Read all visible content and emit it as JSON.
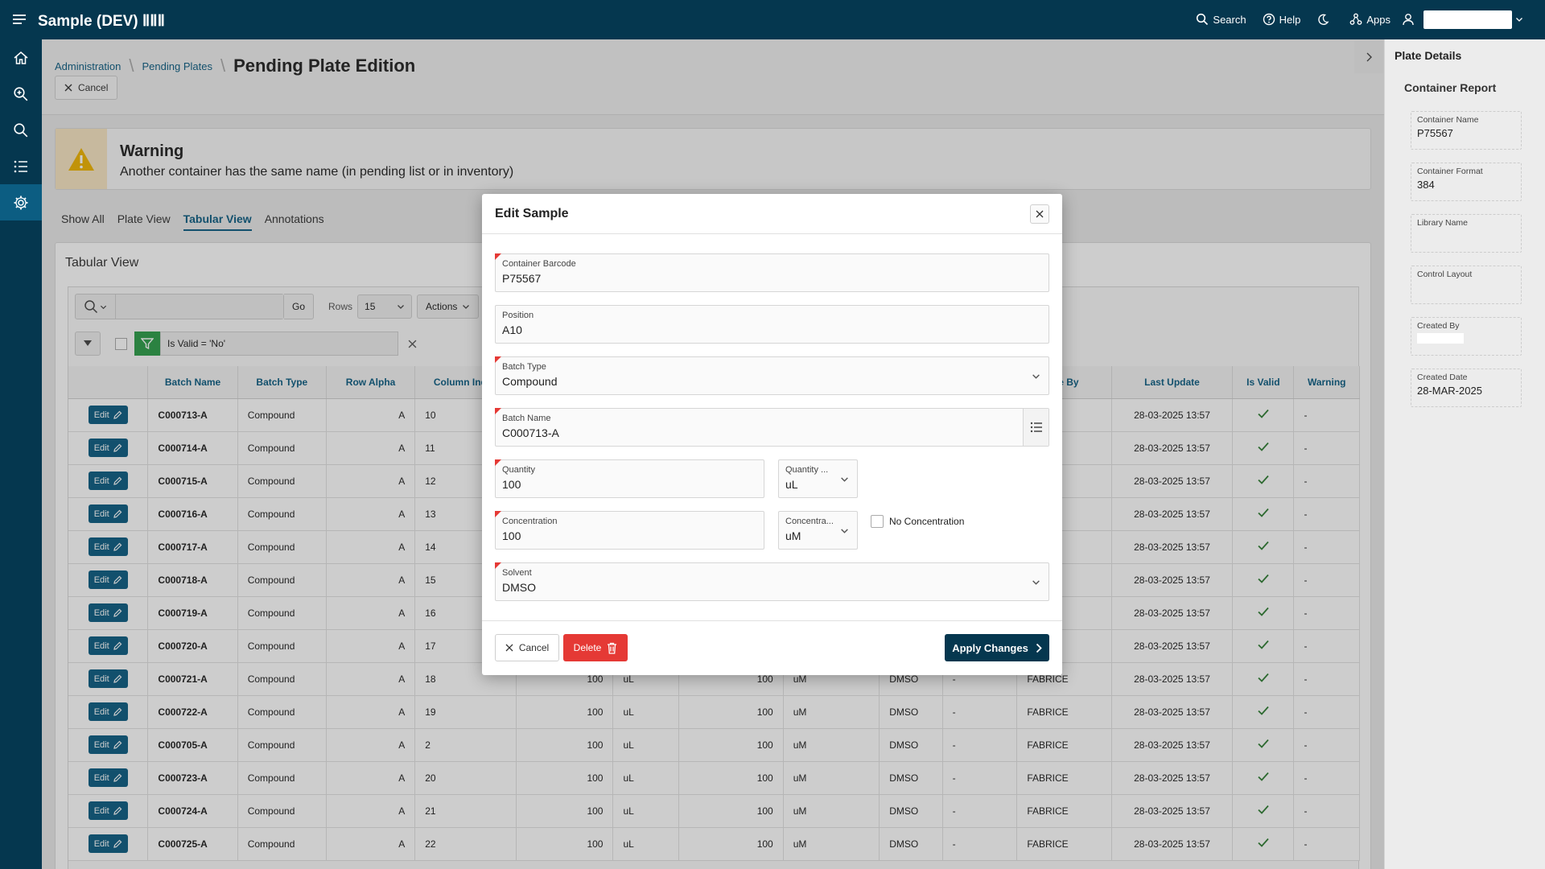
{
  "app": {
    "title": "Sample (DEV) ⅡⅡⅡ"
  },
  "topbar": {
    "search": "Search",
    "help": "Help",
    "apps": "Apps"
  },
  "breadcrumb": {
    "item1": "Administration",
    "item2": "Pending Plates",
    "current": "Pending Plate Edition"
  },
  "header": {
    "cancel_label": "Cancel"
  },
  "warning": {
    "title": "Warning",
    "message": "Another container has the same name (in pending list or in inventory)"
  },
  "tabs": [
    "Show All",
    "Plate View",
    "Tabular View",
    "Annotations"
  ],
  "tabular": {
    "title": "Tabular View",
    "go_label": "Go",
    "rows_label": "Rows",
    "rows_value": "15",
    "actions_label": "Actions",
    "filter_text": "Is Valid = 'No'",
    "edit_label": "Edit",
    "columns": [
      "Batch Name",
      "Batch Type",
      "Row Alpha",
      "Column Index",
      "",
      "",
      "",
      "",
      "",
      "",
      "ate By",
      "Last Update",
      "Is Valid",
      "Warning"
    ],
    "rows": [
      {
        "batch": "C000713-A",
        "type": "Compound",
        "row": "A",
        "col": "10",
        "qty": "",
        "qunit": "",
        "conc": "",
        "cunit": "",
        "solvent": "",
        "ann": "",
        "by": "",
        "update": "28-03-2025 13:57",
        "warning": "-"
      },
      {
        "batch": "C000714-A",
        "type": "Compound",
        "row": "A",
        "col": "11",
        "qty": "",
        "qunit": "",
        "conc": "",
        "cunit": "",
        "solvent": "",
        "ann": "",
        "by": "",
        "update": "28-03-2025 13:57",
        "warning": "-"
      },
      {
        "batch": "C000715-A",
        "type": "Compound",
        "row": "A",
        "col": "12",
        "qty": "",
        "qunit": "",
        "conc": "",
        "cunit": "",
        "solvent": "",
        "ann": "",
        "by": "",
        "update": "28-03-2025 13:57",
        "warning": "-"
      },
      {
        "batch": "C000716-A",
        "type": "Compound",
        "row": "A",
        "col": "13",
        "qty": "",
        "qunit": "",
        "conc": "",
        "cunit": "",
        "solvent": "",
        "ann": "",
        "by": "",
        "update": "28-03-2025 13:57",
        "warning": "-"
      },
      {
        "batch": "C000717-A",
        "type": "Compound",
        "row": "A",
        "col": "14",
        "qty": "",
        "qunit": "",
        "conc": "",
        "cunit": "",
        "solvent": "",
        "ann": "",
        "by": "",
        "update": "28-03-2025 13:57",
        "warning": "-"
      },
      {
        "batch": "C000718-A",
        "type": "Compound",
        "row": "A",
        "col": "15",
        "qty": "",
        "qunit": "",
        "conc": "",
        "cunit": "",
        "solvent": "",
        "ann": "",
        "by": "",
        "update": "28-03-2025 13:57",
        "warning": "-"
      },
      {
        "batch": "C000719-A",
        "type": "Compound",
        "row": "A",
        "col": "16",
        "qty": "",
        "qunit": "",
        "conc": "",
        "cunit": "",
        "solvent": "",
        "ann": "",
        "by": "",
        "update": "28-03-2025 13:57",
        "warning": "-"
      },
      {
        "batch": "C000720-A",
        "type": "Compound",
        "row": "A",
        "col": "17",
        "qty": "",
        "qunit": "",
        "conc": "",
        "cunit": "",
        "solvent": "",
        "ann": "",
        "by": "",
        "update": "28-03-2025 13:57",
        "warning": "-"
      },
      {
        "batch": "C000721-A",
        "type": "Compound",
        "row": "A",
        "col": "18",
        "qty": "100",
        "qunit": "uL",
        "conc": "100",
        "cunit": "uM",
        "solvent": "DMSO",
        "ann": "-",
        "by": "FABRICE",
        "update": "28-03-2025 13:57",
        "warning": "-"
      },
      {
        "batch": "C000722-A",
        "type": "Compound",
        "row": "A",
        "col": "19",
        "qty": "100",
        "qunit": "uL",
        "conc": "100",
        "cunit": "uM",
        "solvent": "DMSO",
        "ann": "-",
        "by": "FABRICE",
        "update": "28-03-2025 13:57",
        "warning": "-"
      },
      {
        "batch": "C000705-A",
        "type": "Compound",
        "row": "A",
        "col": "2",
        "qty": "100",
        "qunit": "uL",
        "conc": "100",
        "cunit": "uM",
        "solvent": "DMSO",
        "ann": "-",
        "by": "FABRICE",
        "update": "28-03-2025 13:57",
        "warning": "-"
      },
      {
        "batch": "C000723-A",
        "type": "Compound",
        "row": "A",
        "col": "20",
        "qty": "100",
        "qunit": "uL",
        "conc": "100",
        "cunit": "uM",
        "solvent": "DMSO",
        "ann": "-",
        "by": "FABRICE",
        "update": "28-03-2025 13:57",
        "warning": "-"
      },
      {
        "batch": "C000724-A",
        "type": "Compound",
        "row": "A",
        "col": "21",
        "qty": "100",
        "qunit": "uL",
        "conc": "100",
        "cunit": "uM",
        "solvent": "DMSO",
        "ann": "-",
        "by": "FABRICE",
        "update": "28-03-2025 13:57",
        "warning": "-"
      },
      {
        "batch": "C000725-A",
        "type": "Compound",
        "row": "A",
        "col": "22",
        "qty": "100",
        "qunit": "uL",
        "conc": "100",
        "cunit": "uM",
        "solvent": "DMSO",
        "ann": "-",
        "by": "FABRICE",
        "update": "28-03-2025 13:57",
        "warning": "-"
      }
    ]
  },
  "right_panel": {
    "title": "Plate Details",
    "subtitle": "Container Report",
    "fields": [
      {
        "label": "Container Name",
        "value": "P75567"
      },
      {
        "label": "Container Format",
        "value": "384"
      },
      {
        "label": "Library Name",
        "value": ""
      },
      {
        "label": "Control Layout",
        "value": ""
      },
      {
        "label": "Created By",
        "value": ""
      },
      {
        "label": "Created Date",
        "value": "28-MAR-2025"
      }
    ]
  },
  "modal": {
    "title": "Edit Sample",
    "container_barcode": {
      "label": "Container Barcode",
      "value": "P75567"
    },
    "position": {
      "label": "Position",
      "value": "A10"
    },
    "batch_type": {
      "label": "Batch Type",
      "value": "Compound"
    },
    "batch_name": {
      "label": "Batch Name",
      "value": "C000713-A"
    },
    "quantity": {
      "label": "Quantity",
      "value": "100"
    },
    "quantity_unit": {
      "label": "Quantity ...",
      "value": "uL"
    },
    "concentration": {
      "label": "Concentration",
      "value": "100"
    },
    "concentration_unit": {
      "label": "Concentra...",
      "value": "uM"
    },
    "no_concentration": {
      "label": "No Concentration"
    },
    "solvent": {
      "label": "Solvent",
      "value": "DMSO"
    },
    "cancel_label": "Cancel",
    "delete_label": "Delete",
    "apply_label": "Apply Changes"
  },
  "colors": {
    "header": "#05374f",
    "accent": "#0c5d82",
    "danger": "#e53935",
    "filter": "#2d9e4a",
    "valid": "#2e7d32"
  },
  "icons": [
    "menu-icon",
    "search-icon",
    "help-icon",
    "moon-icon",
    "apps-icon",
    "user-icon",
    "home-icon",
    "zoom-icon",
    "list-icon",
    "gear-icon",
    "warning-icon",
    "pencil-icon",
    "check-icon",
    "trash-icon",
    "chevron-right-icon"
  ]
}
